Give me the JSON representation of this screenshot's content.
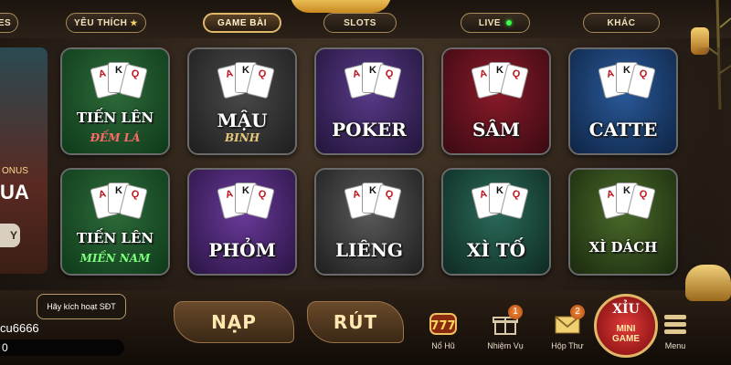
{
  "top_tabs": [
    {
      "label": "ES"
    },
    {
      "label": "YÊU THÍCH"
    },
    {
      "label": "GAME BÀI"
    },
    {
      "label": "SLOTS"
    },
    {
      "label": "LIVE"
    },
    {
      "label": "KHÁC"
    }
  ],
  "favorite_star": "★",
  "left_promo": {
    "line1": "ONUS",
    "line2": "UA",
    "button": "Y"
  },
  "games": [
    {
      "title": "TIẾN LÊN",
      "subtitle": "ĐẾM LÁ",
      "art_top": "#2e6b3a",
      "art_bottom": "#0e3a1a",
      "sub_color": "#ff6a6a"
    },
    {
      "title": "MẬU",
      "subtitle": "BINH",
      "art_top": "#4a4a4a",
      "art_bottom": "#1e1e1e",
      "sub_color": "#e8c97a"
    },
    {
      "title": "POKER",
      "subtitle": "",
      "art_top": "#5a3a8a",
      "art_bottom": "#22153a",
      "sub_color": "#ffffff"
    },
    {
      "title": "SÂM",
      "subtitle": "",
      "art_top": "#8a1a2a",
      "art_bottom": "#3a0a12",
      "sub_color": "#ffffff"
    },
    {
      "title": "CATTE",
      "subtitle": "",
      "art_top": "#2a5a9a",
      "art_bottom": "#0e2444",
      "sub_color": "#ffffff"
    },
    {
      "title": "TIẾN LÊN",
      "subtitle": "MIỀN NAM",
      "art_top": "#2e6b3a",
      "art_bottom": "#0e3a1a",
      "sub_color": "#7cff7c"
    },
    {
      "title": "PHỎM",
      "subtitle": "",
      "art_top": "#6a3a9a",
      "art_bottom": "#2a1444",
      "sub_color": "#ffffff"
    },
    {
      "title": "LIÊNG",
      "subtitle": "",
      "art_top": "#5a5a5a",
      "art_bottom": "#1e1e1e",
      "sub_color": "#ffffff"
    },
    {
      "title": "XÌ TỐ",
      "subtitle": "",
      "art_top": "#2a6a5a",
      "art_bottom": "#0e2a22",
      "sub_color": "#ffffff"
    },
    {
      "title": "XÌ DÁCH",
      "subtitle": "",
      "art_top": "#4a6a2a",
      "art_bottom": "#1a2a0e",
      "sub_color": "#ffffff"
    }
  ],
  "user": {
    "activate_prompt": "Hãy kích hoạt SĐT",
    "username": "cu6666",
    "balance": "0"
  },
  "buttons": {
    "deposit": "NẠP",
    "withdraw": "RÚT"
  },
  "bottom_nav": [
    {
      "label": "Nổ Hũ",
      "icon": "jackpot-777-icon",
      "badge": ""
    },
    {
      "label": "Nhiệm Vụ",
      "icon": "gift-icon",
      "badge": "1"
    },
    {
      "label": "Hộp Thư",
      "icon": "mail-icon",
      "badge": "2"
    },
    {
      "label": "Menu",
      "icon": "menu-icon",
      "badge": ""
    }
  ],
  "mini_game": {
    "label_top": "XỈU",
    "line1": "MINI",
    "line2": "GAME"
  },
  "colors": {
    "accent_gold": "#e0b868",
    "live_dot": "#3cff4a",
    "badge": "#e06a22"
  }
}
